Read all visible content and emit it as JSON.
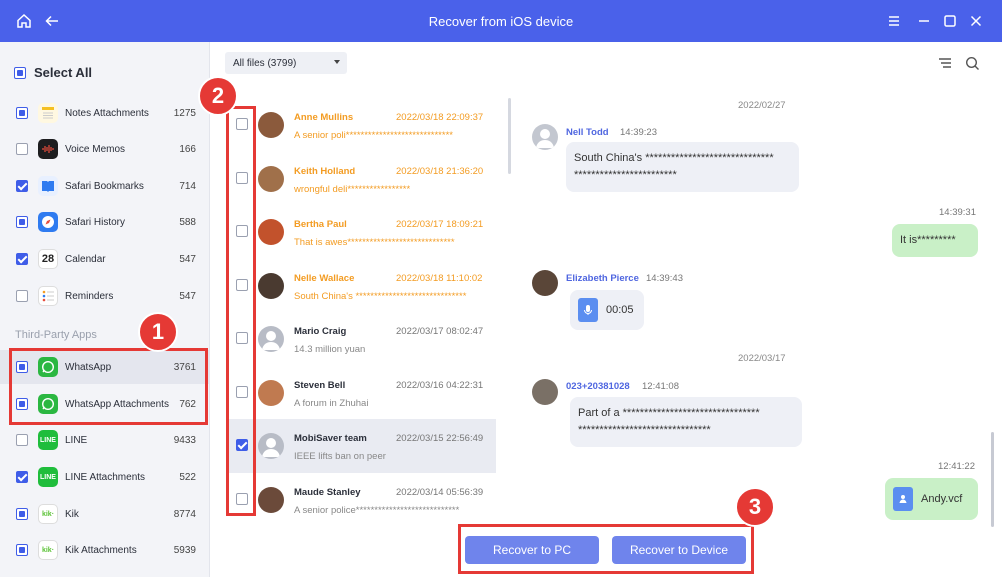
{
  "window": {
    "title": "Recover from iOS device",
    "home_icon": "home-icon",
    "back_icon": "back-arrow-icon",
    "menu_icon": "hamburger-menu-icon",
    "minimize_icon": "minimize-icon",
    "maximize_icon": "maximize-icon",
    "close_icon": "close-icon"
  },
  "sidebar": {
    "select_all": "Select All",
    "third_party_label": "Third-Party Apps",
    "items": [
      {
        "label": "Notes Attachments",
        "count": "1275",
        "state": "partial",
        "icon": "notes-icon"
      },
      {
        "label": "Voice Memos",
        "count": "166",
        "state": "unchecked",
        "icon": "voice-memos-icon"
      },
      {
        "label": "Safari Bookmarks",
        "count": "714",
        "state": "checked",
        "icon": "book-icon"
      },
      {
        "label": "Safari History",
        "count": "588",
        "state": "partial",
        "icon": "compass-icon"
      },
      {
        "label": "Calendar",
        "count": "547",
        "state": "checked",
        "icon": "calendar-icon",
        "icon_text": "28"
      },
      {
        "label": "Reminders",
        "count": "547",
        "state": "unchecked",
        "icon": "reminders-icon"
      },
      {
        "label": "WhatsApp",
        "count": "3761",
        "state": "partial",
        "icon": "whatsapp-icon"
      },
      {
        "label": "WhatsApp Attachments",
        "count": "762",
        "state": "partial",
        "icon": "whatsapp-icon"
      },
      {
        "label": "LINE",
        "count": "9433",
        "state": "unchecked",
        "icon": "line-icon",
        "icon_text": "LINE"
      },
      {
        "label": "LINE Attachments",
        "count": "522",
        "state": "checked",
        "icon": "line-icon",
        "icon_text": "LINE"
      },
      {
        "label": "Kik",
        "count": "8774",
        "state": "partial",
        "icon": "kik-icon",
        "icon_text": "kik·"
      },
      {
        "label": "Kik Attachments",
        "count": "5939",
        "state": "partial",
        "icon": "kik-icon",
        "icon_text": "kik·"
      }
    ]
  },
  "annotations": {
    "one": "1",
    "two": "2",
    "three": "3"
  },
  "filter": {
    "label": "All files (3799)"
  },
  "toolbar": {
    "filter_icon": "filter-lines-icon",
    "search_icon": "search-icon"
  },
  "chats": [
    {
      "name": "Anne Mullins",
      "time": "2022/03/18 22:09:37",
      "preview": "A senior poli*****************************",
      "unread": true,
      "checked": false,
      "color": "#8b5a3c"
    },
    {
      "name": "Keith Holland",
      "time": "2022/03/18 21:36:20",
      "preview": "wrongful deli*****************",
      "unread": true,
      "checked": false,
      "color": "#a0704a"
    },
    {
      "name": "Bertha Paul",
      "time": "2022/03/17 18:09:21",
      "preview": "That is awes*****************************",
      "unread": true,
      "checked": false,
      "color": "#c2522c"
    },
    {
      "name": "Nelle Wallace",
      "time": "2022/03/18 11:10:02",
      "preview": "South China's ******************************",
      "unread": true,
      "checked": false,
      "color": "#4a3a30"
    },
    {
      "name": "Mario Craig",
      "time": "2022/03/17 08:02:47",
      "preview": "14.3 million yuan",
      "unread": false,
      "checked": false,
      "color": "#b8bcc6",
      "placeholder": true
    },
    {
      "name": "Steven Bell",
      "time": "2022/03/16 04:22:31",
      "preview": "A forum in Zhuhai",
      "unread": false,
      "checked": false,
      "color": "#c07a50"
    },
    {
      "name": "MobiSaver team",
      "time": "2022/03/15 22:56:49",
      "preview": "IEEE lifts ban on peer",
      "unread": false,
      "checked": true,
      "color": "#b8bcc6",
      "placeholder": true
    },
    {
      "name": "Maude Stanley",
      "time": "2022/03/14 05:56:39",
      "preview": "A senior police****************************",
      "unread": false,
      "checked": false,
      "color": "#6b4a3a"
    }
  ],
  "conversation": {
    "date1": "2022/02/27",
    "msg1": {
      "name": "Nell Todd",
      "time": "14:39:23",
      "line1": "South China's ******************************",
      "line2": "************************"
    },
    "msg2": {
      "time": "14:39:31",
      "text": "It is*********"
    },
    "msg3": {
      "name": "Elizabeth Pierce",
      "time": "14:39:43",
      "duration": "00:05"
    },
    "date2": "2022/03/17",
    "msg4": {
      "name": "023+20381028",
      "time": "12:41:08",
      "line1": "Part of a ********************************",
      "line2": "*******************************"
    },
    "msg5": {
      "time": "12:41:22",
      "file": "Andy.vcf"
    }
  },
  "buttons": {
    "recover_pc": "Recover to PC",
    "recover_device": "Recover to Device"
  },
  "colors": {
    "accent": "#4a61ea",
    "unread": "#f39c23",
    "annotation": "#e53935",
    "my_bubble": "#c9f0c7"
  }
}
